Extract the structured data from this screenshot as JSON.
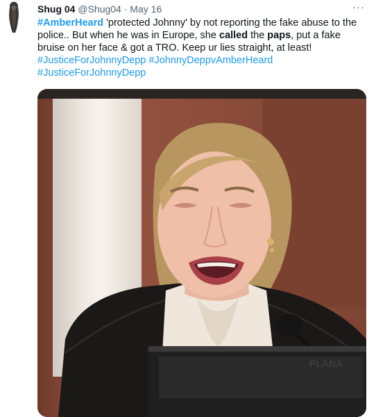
{
  "tweet": {
    "display_name": "Shug 04",
    "handle": "@Shug04",
    "separator": "·",
    "date": "May 16",
    "more_label": "···",
    "text_segments": [
      {
        "text": "#AmberHeard",
        "style": "hashtag-bold"
      },
      {
        "text": " 'protected Johnny' by not reporting the fake abuse to the police.. But when he was in Europe, she ",
        "style": "plain"
      },
      {
        "text": "called",
        "style": "bold"
      },
      {
        "text": " the ",
        "style": "plain"
      },
      {
        "text": "paps",
        "style": "bold"
      },
      {
        "text": ", put a fake bruise on her face & got a TRO. Keep ur lies straight, at least!",
        "style": "plain"
      }
    ],
    "hashtags": [
      "#JusticeForJohnnyDepp",
      "#JohnnyDeppvAmberHeard",
      "#JusticeForJohnnyDepp"
    ]
  },
  "icons": {
    "avatar": "profile-photo",
    "more": "more-options-icon"
  },
  "colors": {
    "link": "#1d9bf0",
    "text": "#0f1419",
    "secondary": "#536471"
  },
  "media": {
    "description_icon": "photo-of-woman-crying-in-courtroom",
    "nameplate_text": "PLANA"
  }
}
